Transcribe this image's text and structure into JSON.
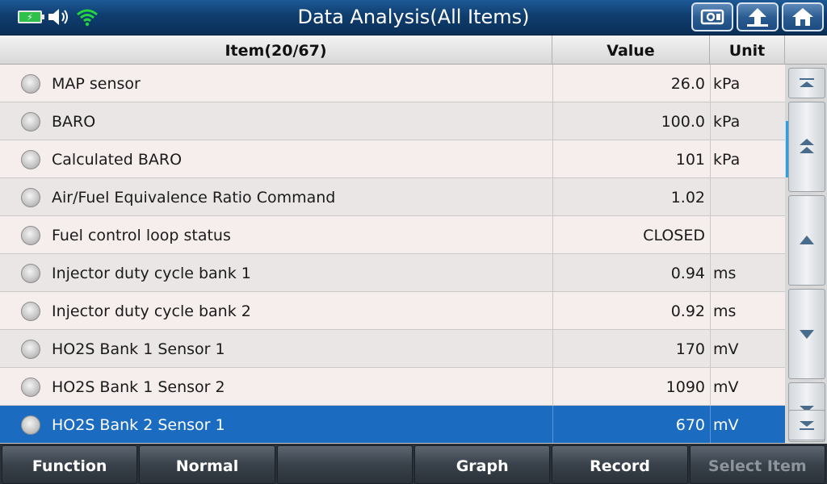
{
  "header": {
    "title": "Data Analysis(All Items)",
    "battery_icon": "battery-charging-icon",
    "speaker_icon": "speaker-icon",
    "wifi_icon": "wifi-icon",
    "buttons": [
      {
        "icon": "screenshot-icon"
      },
      {
        "icon": "back-up-arrow-icon"
      },
      {
        "icon": "home-icon"
      }
    ]
  },
  "table": {
    "columns": {
      "item": "Item(20/67)",
      "value": "Value",
      "unit": "Unit"
    },
    "rows": [
      {
        "name": "MAP sensor",
        "value": "26.0",
        "unit": "kPa"
      },
      {
        "name": "BARO",
        "value": "100.0",
        "unit": "kPa"
      },
      {
        "name": "Calculated BARO",
        "value": "101",
        "unit": "kPa"
      },
      {
        "name": "Air/Fuel Equivalence Ratio Command",
        "value": "1.02",
        "unit": ""
      },
      {
        "name": "Fuel control loop status",
        "value": "CLOSED",
        "unit": ""
      },
      {
        "name": "Injector duty cycle bank 1",
        "value": "0.94",
        "unit": "ms"
      },
      {
        "name": "Injector duty cycle bank 2",
        "value": "0.92",
        "unit": "ms"
      },
      {
        "name": "HO2S Bank 1 Sensor 1",
        "value": "170",
        "unit": "mV"
      },
      {
        "name": "HO2S Bank 1 Sensor 2",
        "value": "1090",
        "unit": "mV"
      },
      {
        "name": "HO2S Bank 2 Sensor 1",
        "value": "670",
        "unit": "mV"
      }
    ],
    "selected_row": 9
  },
  "scrollbar": {
    "buttons": [
      "scroll-top-icon",
      "page-up-icon",
      "line-up-icon",
      "line-down-icon",
      "page-down-icon",
      "scroll-bottom-icon"
    ]
  },
  "footer": {
    "buttons": [
      {
        "label": "Function",
        "enabled": true
      },
      {
        "label": "Normal",
        "enabled": true
      },
      {
        "label": "",
        "enabled": true
      },
      {
        "label": "Graph",
        "enabled": true
      },
      {
        "label": "Record",
        "enabled": true
      },
      {
        "label": "Select Item",
        "enabled": false
      }
    ]
  },
  "colors": {
    "title_bar": "#0f3d6e",
    "selected_row": "#1b6cc0",
    "scroll_indicator": "#2aa0e8",
    "battery": "#2ec04a",
    "wifi": "#22d640"
  }
}
